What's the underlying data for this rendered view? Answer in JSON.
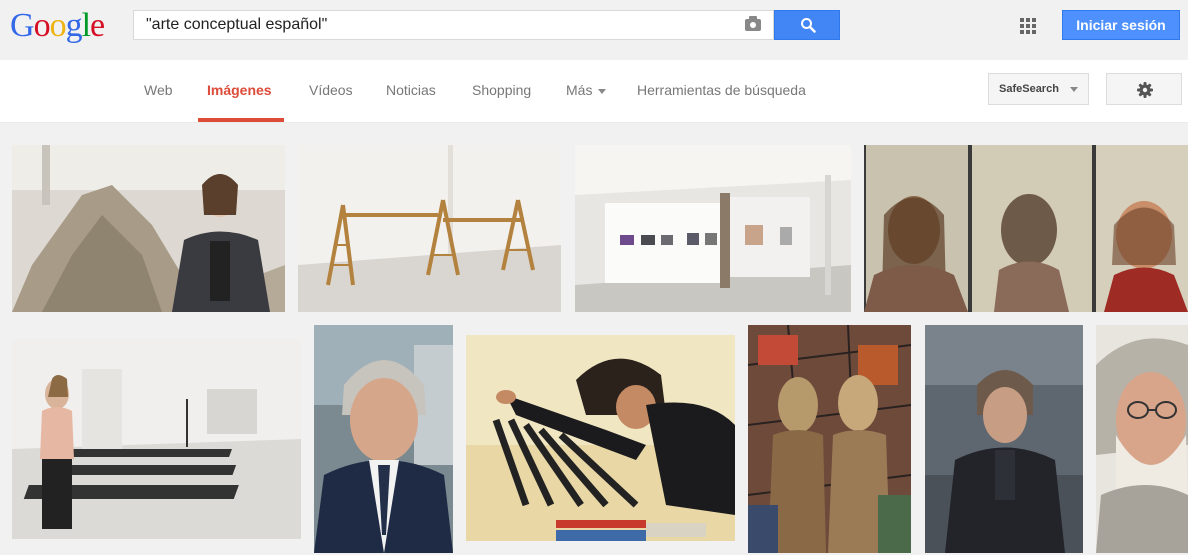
{
  "header": {
    "logo_letters": [
      {
        "ch": "G",
        "color": "#3369e8"
      },
      {
        "ch": "o",
        "color": "#d50f25"
      },
      {
        "ch": "o",
        "color": "#eeb211"
      },
      {
        "ch": "g",
        "color": "#3369e8"
      },
      {
        "ch": "l",
        "color": "#009925"
      },
      {
        "ch": "e",
        "color": "#d50f25"
      }
    ],
    "search_query": "\"arte conceptual español\"",
    "signin_label": "Iniciar sesión"
  },
  "nav": {
    "web": "Web",
    "images": "Imágenes",
    "videos": "Vídeos",
    "news": "Noticias",
    "shopping": "Shopping",
    "more": "Más",
    "tools": "Herramientas de búsqueda"
  },
  "safesearch_label": "SafeSearch",
  "images": [
    {
      "name": "woman-with-rock-pile"
    },
    {
      "name": "ladders-installation"
    },
    {
      "name": "gallery-exhibition"
    },
    {
      "name": "ecce-homo-fresco"
    },
    {
      "name": "woman-in-gallery-inadequate"
    },
    {
      "name": "man-with-tie"
    },
    {
      "name": "artist-arranging-strips"
    },
    {
      "name": "abstract-figures-painting"
    },
    {
      "name": "man-in-black-shirt"
    },
    {
      "name": "painted-portrait-glasses"
    }
  ]
}
